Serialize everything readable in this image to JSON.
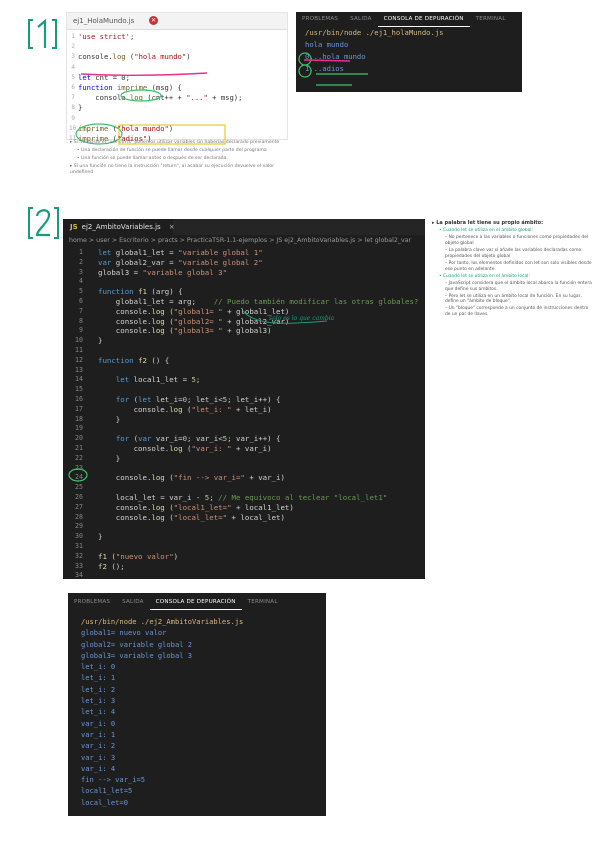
{
  "marks": {
    "section1": "1",
    "section2": "2"
  },
  "editor1": {
    "tab_label": "ej1_HolaMundo.js",
    "lines": [
      {
        "num": "1",
        "code": "'use strict';"
      },
      {
        "num": "2",
        "code": ""
      },
      {
        "num": "3",
        "code": "console.log (\"hola mundo\")"
      },
      {
        "num": "4",
        "code": ""
      },
      {
        "num": "5",
        "code": "let cnt = 0;"
      },
      {
        "num": "6",
        "code": "function imprime (msg) {"
      },
      {
        "num": "7",
        "code": "    console.log (cnt++ + \"...\" + msg);"
      },
      {
        "num": "8",
        "code": "}"
      },
      {
        "num": "9",
        "code": ""
      },
      {
        "num": "10",
        "code": "imprime (\"hola mundo\")"
      },
      {
        "num": "11",
        "code": "imprime (\"adios\")"
      }
    ]
  },
  "notes1": [
    "Si no existe el \"use strict\" podemos utilizar variables sin haberlas declarado previamente",
    "Una declaración de función se puede llamar desde cualquier parte del programa",
    "Una función se puede llamar antes o después de ser declarada",
    "Si una función no tiene la instrucción \"return\", al acabar su ejecución devuelve el valor undefined"
  ],
  "terminal1": {
    "tabs": [
      "PROBLEMAS",
      "SALIDA",
      "CONSOLA DE DEPURACIÓN",
      "TERMINAL"
    ],
    "active_tab": "CONSOLA DE DEPURACIÓN",
    "lines": [
      {
        "text": "/usr/bin/node ./ej1_holaMundo.js",
        "kind": "cmd"
      },
      {
        "text": "hola mundo",
        "kind": "out"
      },
      {
        "text": "0...hola mundo",
        "kind": "out"
      },
      {
        "text": "1...adios",
        "kind": "out"
      }
    ],
    "circled": [
      "0",
      "1"
    ]
  },
  "editor2": {
    "tab_label": "ej2_AmbitoVariables.js",
    "breadcrumb": "home > user > Escritorio > practs > PracticaTSR-1.1-ejemplos > JS ej2_AmbitoVariables.js > let global2_var",
    "annotation": "solo es lo que cambia",
    "lines": [
      {
        "num": "1",
        "code": "let global1_let = \"variable global 1\""
      },
      {
        "num": "2",
        "code": "var global2_var = \"variable global 2\""
      },
      {
        "num": "3",
        "code": "global3 = \"variable global 3\""
      },
      {
        "num": "4",
        "code": ""
      },
      {
        "num": "5",
        "code": "function f1 (arg) {"
      },
      {
        "num": "6",
        "code": "    global1_let = arg;    // Puedo también modificar las otras globales?"
      },
      {
        "num": "7",
        "code": "    console.log (\"global1= \" + global1_let)"
      },
      {
        "num": "8",
        "code": "    console.log (\"global2= \" + global2_var)"
      },
      {
        "num": "9",
        "code": "    console.log (\"global3= \" + global3)"
      },
      {
        "num": "10",
        "code": "}"
      },
      {
        "num": "11",
        "code": ""
      },
      {
        "num": "12",
        "code": "function f2 () {"
      },
      {
        "num": "13",
        "code": ""
      },
      {
        "num": "14",
        "code": "    let local1_let = 5;"
      },
      {
        "num": "15",
        "code": ""
      },
      {
        "num": "16",
        "code": "    for (let let_i=0; let_i<5; let_i++) {"
      },
      {
        "num": "17",
        "code": "        console.log (\"let_i: \" + let_i)"
      },
      {
        "num": "18",
        "code": "    }"
      },
      {
        "num": "19",
        "code": ""
      },
      {
        "num": "20",
        "code": "    for (var var_i=0; var_i<5; var_i++) {"
      },
      {
        "num": "21",
        "code": "        console.log (\"var_i: \" + var_i)"
      },
      {
        "num": "22",
        "code": "    }"
      },
      {
        "num": "23",
        "code": ""
      },
      {
        "num": "24",
        "code": "    console.log (\"fin --> var_i=\" + var_i)"
      },
      {
        "num": "25",
        "code": ""
      },
      {
        "num": "26",
        "code": "    local_let = var_i - 5; // Me equivoco al teclear \"local_let1\""
      },
      {
        "num": "27",
        "code": "    console.log (\"local1_let=\" + local1_let)"
      },
      {
        "num": "28",
        "code": "    console.log (\"local_let=\" + local_let)"
      },
      {
        "num": "29",
        "code": ""
      },
      {
        "num": "30",
        "code": "}"
      },
      {
        "num": "31",
        "code": ""
      },
      {
        "num": "32",
        "code": "f1 (\"nuevo valor\")"
      },
      {
        "num": "33",
        "code": "f2 ();"
      },
      {
        "num": "34",
        "code": ""
      }
    ]
  },
  "notes2": [
    {
      "level": 0,
      "text": "La palabra let tiene su propio ámbito:"
    },
    {
      "level": 1,
      "text": "Cuando let se utiliza en el ámbito global:"
    },
    {
      "level": 2,
      "text": "No pertenece a las variables o funciones como propiedades del objeto global"
    },
    {
      "level": 2,
      "text": "La palabra clave var sí añade las variables declaradas como propiedades del objeto global"
    },
    {
      "level": 2,
      "text": "Por tanto, los elementos definidos con let son solo visibles desde ese punto en adelante."
    },
    {
      "level": 1,
      "text": "Cuando let se utiliza en el ámbito local:"
    },
    {
      "level": 2,
      "text": "JavaScript considera que el ámbito local abarca la función entera que define sus ámbitos."
    },
    {
      "level": 2,
      "text": "Pero let se utiliza en un ámbito local de función. En su lugar, define un \"ámbito de bloque\"."
    },
    {
      "level": 2,
      "text": "Un \"bloque\" corresponde a un conjunto de instrucciones dentro de un par de llaves."
    }
  ],
  "terminal2": {
    "tabs": [
      "PROBLEMAS",
      "SALIDA",
      "CONSOLA DE DEPURACIÓN",
      "TERMINAL"
    ],
    "active_tab": "CONSOLA DE DEPURACIÓN",
    "lines": [
      {
        "text": "/usr/bin/node ./ej2_AmbitoVariables.js",
        "kind": "cmd"
      },
      {
        "text": "global1= nuevo valor",
        "kind": "out"
      },
      {
        "text": "global2= variable global 2",
        "kind": "out"
      },
      {
        "text": "global3= variable global 3",
        "kind": "out"
      },
      {
        "text": "let_i: 0",
        "kind": "out"
      },
      {
        "text": "let_i: 1",
        "kind": "out"
      },
      {
        "text": "let_i: 2",
        "kind": "out"
      },
      {
        "text": "let_i: 3",
        "kind": "out"
      },
      {
        "text": "let_i: 4",
        "kind": "out"
      },
      {
        "text": "var_i: 0",
        "kind": "out"
      },
      {
        "text": "var_i: 1",
        "kind": "out"
      },
      {
        "text": "var_i: 2",
        "kind": "out"
      },
      {
        "text": "var_i: 3",
        "kind": "out"
      },
      {
        "text": "var_i: 4",
        "kind": "out"
      },
      {
        "text": "fin --> var_i=5",
        "kind": "out"
      },
      {
        "text": "local1_let=5",
        "kind": "out"
      },
      {
        "text": "local_let=0",
        "kind": "out"
      }
    ]
  },
  "colors": {
    "handwriting": "#1a9b7c",
    "highlight_pink": "#e8308a",
    "highlight_green": "#3cc36a",
    "dark_bg": "#1e1e1e",
    "terminal_cmd": "#d7ba7d",
    "terminal_out": "#6c96d8"
  }
}
